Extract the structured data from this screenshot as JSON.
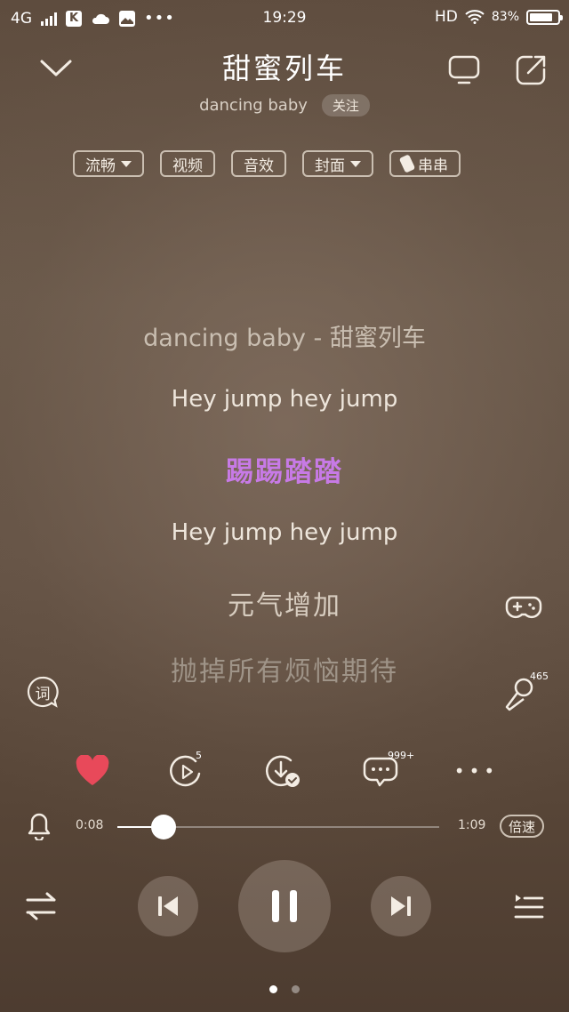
{
  "status_bar": {
    "network": "4G",
    "app_badge": "K",
    "time": "19:29",
    "hd": "HD",
    "battery": "83%",
    "battery_level": 0.83
  },
  "header": {
    "song_title": "甜蜜列车",
    "artist": "dancing baby",
    "follow_label": "关注"
  },
  "chips": [
    {
      "label": "流畅",
      "caret": true
    },
    {
      "label": "视频"
    },
    {
      "label": "音效"
    },
    {
      "label": "封面",
      "caret": true
    },
    {
      "label": "串串",
      "icon": "pill-icon"
    }
  ],
  "lyrics": [
    "dancing baby - 甜蜜列车",
    "Hey jump hey jump",
    "踢踢踏踏",
    "Hey jump hey jump",
    "元气增加",
    "抛掉所有烦恼期待"
  ],
  "lyrics_active_index": 2,
  "side": {
    "lyric_button": "词",
    "mic_count": "465"
  },
  "actions": {
    "like_color": "#e8495a",
    "video_count": "5",
    "comment_count": "999+"
  },
  "progress": {
    "current": "0:08",
    "total": "1:09",
    "fraction": 0.145,
    "speed_label": "倍速"
  },
  "pager": {
    "pages": 2,
    "current": 0
  },
  "colors": {
    "active_lyric": "#c77ae6",
    "accent_like": "#e8495a"
  }
}
